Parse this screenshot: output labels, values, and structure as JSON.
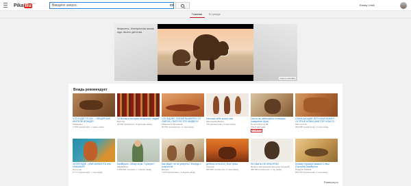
{
  "header": {
    "logo_a": "Pika",
    "logo_b": "Bu",
    "logo_c": "CA",
    "search_placeholder": "Введите запрос",
    "user_name": "Elaray Lhick"
  },
  "tabs": [
    {
      "label": "Главная",
      "active": true
    },
    {
      "label": "В тренде",
      "active": false
    }
  ],
  "banner": {
    "text": "Мамонты. Интересная жизнь еды твоего детства",
    "caption": "Скрыть рекламу"
  },
  "recommended": {
    "title": "Вождь рекомендует",
    "expand_label": "Развернуть",
    "cards": [
      {
        "title": "ЧТО БУДЕТ ЕСЛИ ... ПЕЩЕРНЫЕ ЖИТЕЛИ ВОЖДЯ?",
        "channel": "Жвадрасы",
        "meta": "4 756 просмотров • 1 день назад",
        "badge": ""
      },
      {
        "title": "10 Битвы в истории пещерных людей",
        "channel": "Бой Тор",
        "meta": "46 002 просмотра • 9 месяцев назад",
        "badge": ""
      },
      {
        "title": "СОСЕДНЕЕ ПЛЕМЯ ВЫМЕРЛО ОТ СМЕХА, СМОТРИ ЭТО ВИДЕО!!!",
        "channel": "Камешки из Вулканов",
        "meta": "66 670 просмотров • 2 года назад",
        "badge": ""
      },
      {
        "title": "Наточка себе копье сам",
        "channel": "Мастерская Вьюги",
        "meta": "770 просмотров • 3 года назад",
        "badge": ""
      },
      {
        "title": "Охота на саблезубых в пещере (ожирение Куга)",
        "channel": "Полное Братье #8",
        "meta": "3 512 зрителей",
        "badge": "В ЭФИРЕ"
      },
      {
        "title": "ОЗНАЧАЮЩИЕ ИГРУШКИ КАМНЯ ОСТРЫЕ НОЖИ (МАСТЕР-КЛАСС)",
        "channel": "Мастер Гоко",
        "meta": "234 025 просмотров • 2 года назад",
        "badge": ""
      },
      {
        "title": "ЧЕЛЛЕНДЖ - убей МАМОНТА или НАКАЖИ!!!",
        "channel": "Нуучуеде",
        "meta": "6 777 просмотров • 1 год назад",
        "badge": ""
      },
      {
        "title": "MadByson. Обзор игры \"Суперон\"",
        "channel": "МадБайсон",
        "meta": "3 266 021 просмотр • 1 месяц назад",
        "badge": ""
      },
      {
        "title": "Как уйдёт ли не умереть? Беседа с старостой",
        "channel": "Вьюдок",
        "meta": "7 239 просмотров • 4 недели назад",
        "badge": ""
      },
      {
        "title": "дебилы огня #14 | Вся тупка",
        "channel": "Хорский",
        "meta": "960 633 просмотра • 2 года назад",
        "badge": ""
      },
      {
        "title": "ЛЮ ВАНЬ НЕ ИНКОРИК!",
        "channel": "Фанаты дисгармонии Аргентор Куорский",
        "meta": "456 303 просмотра • 1 год назад",
        "badge": ""
      },
      {
        "title": "почему страшно мамою Слэш! (Гастрей) MadBySon",
        "channel": "Подарок Хайяма",
        "meta": "200 700 просмотров • 1 год назад",
        "badge": ""
      }
    ]
  }
}
